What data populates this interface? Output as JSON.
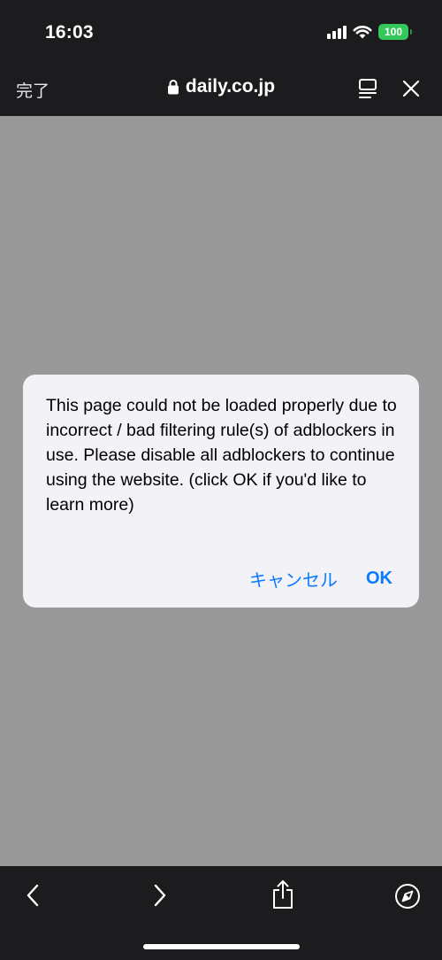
{
  "status_bar": {
    "time": "16:03",
    "battery_level": "100",
    "battery_color": "#34c759"
  },
  "nav_bar": {
    "done_label": "完了",
    "url": "daily.co.jp",
    "icons": [
      "lock-icon",
      "reader-mode-icon",
      "close-icon"
    ]
  },
  "dialog": {
    "message": "This page could not be loaded properly due to incorrect / bad filtering rule(s) of adblockers in use. Please disable all adblockers to continue using the website. (click OK if you'd like to learn more)",
    "cancel_label": "キャンセル",
    "ok_label": "OK",
    "accent_color": "#0a7aff"
  },
  "toolbar": {
    "icons": [
      "back-icon",
      "forward-icon",
      "share-icon",
      "compass-icon"
    ]
  }
}
